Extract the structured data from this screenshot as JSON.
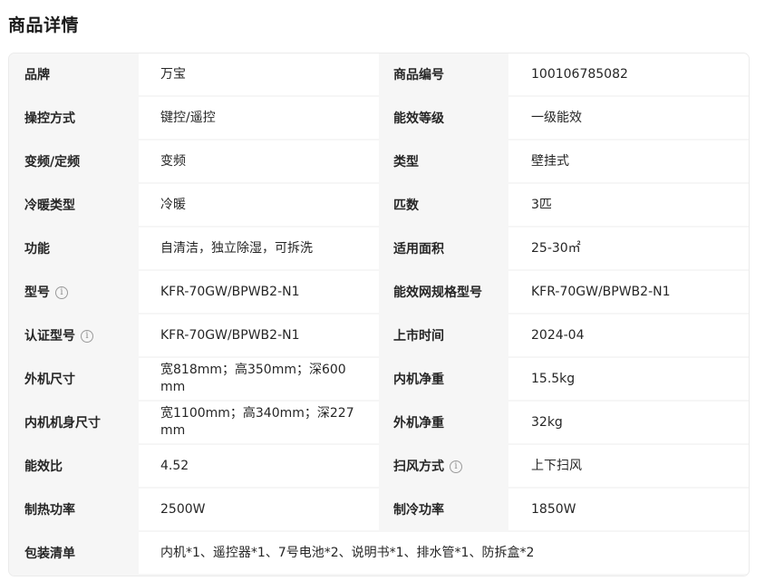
{
  "page_title": "商品详情",
  "rows": [
    {
      "l1": "品牌",
      "v1": "万宝",
      "l2": "商品编号",
      "v2": "100106785082"
    },
    {
      "l1": "操控方式",
      "v1": "键控/遥控",
      "l2": "能效等级",
      "v2": "一级能效"
    },
    {
      "l1": "变频/定频",
      "v1": "变频",
      "l2": "类型",
      "v2": "壁挂式"
    },
    {
      "l1": "冷暖类型",
      "v1": "冷暖",
      "l2": "匹数",
      "v2": "3匹"
    },
    {
      "l1": "功能",
      "v1": "自清洁，独立除湿，可拆洗",
      "l2": "适用面积",
      "v2": "25-30㎡"
    },
    {
      "l1": "型号",
      "v1": "KFR-70GW/BPWB2-N1",
      "l2": "能效网规格型号",
      "v2": "KFR-70GW/BPWB2-N1"
    },
    {
      "l1": "认证型号",
      "v1": "KFR-70GW/BPWB2-N1",
      "l2": "上市时间",
      "v2": "2024-04"
    },
    {
      "l1": "外机尺寸",
      "v1": "宽818mm；高350mm；深600mm",
      "l2": "内机净重",
      "v2": "15.5kg"
    },
    {
      "l1": "内机机身尺寸",
      "v1": "宽1100mm；高340mm；深227mm",
      "l2": "外机净重",
      "v2": "32kg"
    },
    {
      "l1": "能效比",
      "v1": "4.52",
      "l2": "扫风方式",
      "v2": "上下扫风"
    },
    {
      "l1": "制热功率",
      "v1": "2500W",
      "l2": "制冷功率",
      "v2": "1850W"
    }
  ],
  "last_row": {
    "label": "包装清单",
    "value": "内机*1、遥控器*1、7号电池*2、说明书*1、排水管*1、防拆盒*2"
  },
  "info_icon_glyph": "i"
}
